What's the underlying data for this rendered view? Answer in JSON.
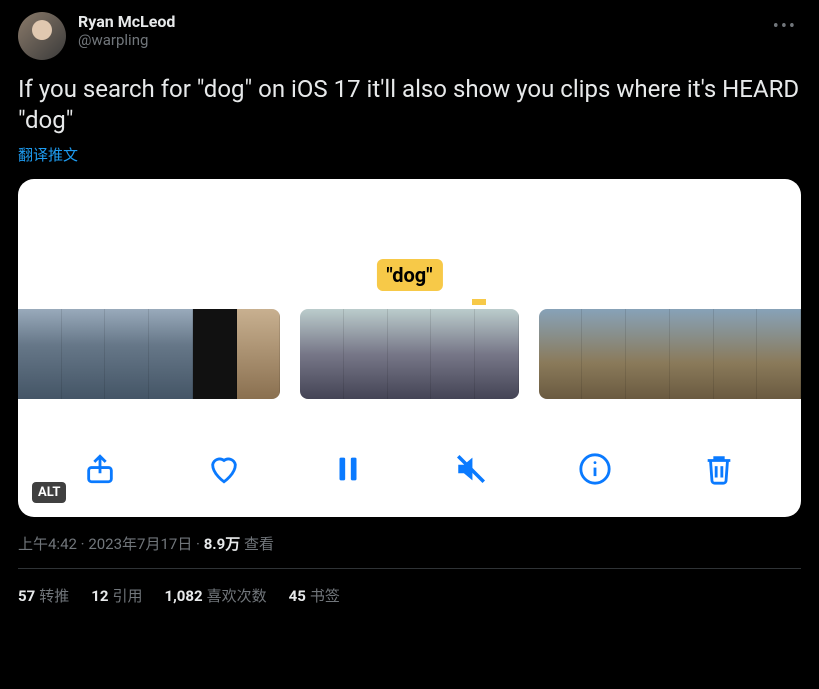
{
  "author": {
    "display_name": "Ryan McLeod",
    "handle": "@warpling"
  },
  "tweet_text": "If you search for \"dog\" on iOS 17 it'll also show you clips where it's HEARD \"dog\"",
  "translate_label": "翻译推文",
  "media": {
    "search_label": "\"dog\"",
    "alt_badge": "ALT"
  },
  "meta": {
    "time": "上午4:42",
    "date": "2023年7月17日",
    "views_number": "8.9万",
    "views_label": "查看",
    "separator": " · "
  },
  "stats": {
    "retweets": {
      "count": "57",
      "label": "转推"
    },
    "quotes": {
      "count": "12",
      "label": "引用"
    },
    "likes": {
      "count": "1,082",
      "label": "喜欢次数"
    },
    "bookmarks": {
      "count": "45",
      "label": "书签"
    }
  },
  "icons": {
    "share": "share-icon",
    "heart": "heart-icon",
    "pause": "pause-icon",
    "mute": "mute-icon",
    "info": "info-icon",
    "trash": "trash-icon",
    "more": "more-icon"
  },
  "colors": {
    "ios_blue": "#0a7aff",
    "twitter_blue": "#1d9bf0",
    "highlight": "#f7c948"
  }
}
